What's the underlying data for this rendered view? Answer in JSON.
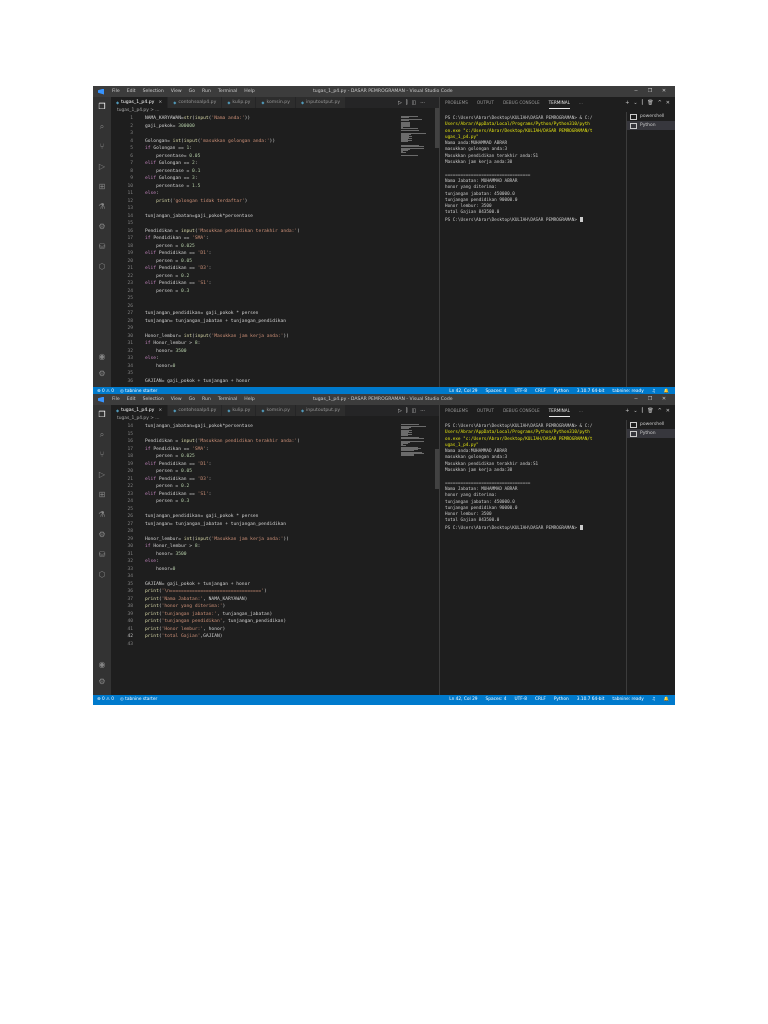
{
  "titlebar": {
    "menu": [
      "File",
      "Edit",
      "Selection",
      "View",
      "Go",
      "Run",
      "Terminal",
      "Help"
    ],
    "title": "tugas_1_p4.py - DASAR PEMROGRAMAN - Visual Studio Code",
    "controls": [
      "─",
      "❐",
      "✕"
    ]
  },
  "tabs": [
    {
      "label": "tugas_1_p4.py",
      "active": true
    },
    {
      "label": "contohsoalp4.py",
      "active": false
    },
    {
      "label": "kulip.py",
      "active": false
    },
    {
      "label": "komsin.py",
      "active": false
    },
    {
      "label": "inputoutput.py",
      "active": false
    }
  ],
  "editor_actions": [
    "▷",
    "⫿",
    "◫",
    "⋯"
  ],
  "breadcrumb": "tugas_1_p4.py > ...",
  "code_top": [
    {
      "n": "1",
      "t": "NAMA_KARYAWAN=str(input('Nama anda:'))"
    },
    {
      "n": "2",
      "t": "gaji_pokok= 300000"
    },
    {
      "n": "3",
      "t": ""
    },
    {
      "n": "4",
      "t": "Golongan= int(input('masukkan golongan anda:'))"
    },
    {
      "n": "5",
      "t": "if Golongan == 1:"
    },
    {
      "n": "6",
      "t": "    persentase= 0.05"
    },
    {
      "n": "7",
      "t": "elif Golongan == 2:"
    },
    {
      "n": "8",
      "t": "    persentase = 0.1"
    },
    {
      "n": "9",
      "t": "elif Golongan == 3:"
    },
    {
      "n": "10",
      "t": "    persentase = 1.5"
    },
    {
      "n": "11",
      "t": "else:"
    },
    {
      "n": "12",
      "t": "    print('golongan tidak terdaftar')"
    },
    {
      "n": "13",
      "t": ""
    },
    {
      "n": "14",
      "t": "tunjangan_jabatan=gaji_pokok*persentase"
    },
    {
      "n": "15",
      "t": ""
    },
    {
      "n": "16",
      "t": "Pendidikan = input('Masukkan pendidikan terakhir anda:')"
    },
    {
      "n": "17",
      "t": "if Pendidikan == 'SMA':"
    },
    {
      "n": "18",
      "t": "    persen = 0.025"
    },
    {
      "n": "19",
      "t": "elif Pendidikan == 'D1':"
    },
    {
      "n": "20",
      "t": "    persen = 0.05"
    },
    {
      "n": "21",
      "t": "elif Pendidikan == 'D3':"
    },
    {
      "n": "22",
      "t": "    persen = 0.2"
    },
    {
      "n": "23",
      "t": "elif Pendidikan == 'S1':"
    },
    {
      "n": "24",
      "t": "    persen = 0.3"
    },
    {
      "n": "25",
      "t": ""
    },
    {
      "n": "26",
      "t": ""
    },
    {
      "n": "27",
      "t": "tunjangan_pendidikan= gaji_pokok * persen"
    },
    {
      "n": "28",
      "t": "tunjangan= tunjangan_jabatan + tunjangan_pendidikan"
    },
    {
      "n": "29",
      "t": ""
    },
    {
      "n": "30",
      "t": "Honor_lembur= int(input('Masukkan jam kerja anda:'))"
    },
    {
      "n": "31",
      "t": "if Honor_lembur > 8:"
    },
    {
      "n": "32",
      "t": "    honor= 3500"
    },
    {
      "n": "33",
      "t": "else:"
    },
    {
      "n": "34",
      "t": "    honor=0"
    },
    {
      "n": "35",
      "t": ""
    },
    {
      "n": "36",
      "t": "GAJIAN= gaji_pokok + tunjangan + honor"
    }
  ],
  "code_bottom": [
    {
      "n": "14",
      "t": "tunjangan_jabatan=gaji_pokok*persentase"
    },
    {
      "n": "15",
      "t": ""
    },
    {
      "n": "16",
      "t": "Pendidikan = input('Masukkan pendidikan terakhir anda:')"
    },
    {
      "n": "17",
      "t": "if Pendidikan == 'SMA':"
    },
    {
      "n": "18",
      "t": "    persen = 0.025"
    },
    {
      "n": "19",
      "t": "elif Pendidikan == 'D1':"
    },
    {
      "n": "20",
      "t": "    persen = 0.05"
    },
    {
      "n": "21",
      "t": "elif Pendidikan == 'D3':"
    },
    {
      "n": "22",
      "t": "    persen = 0.2"
    },
    {
      "n": "23",
      "t": "elif Pendidikan == 'S1':"
    },
    {
      "n": "24",
      "t": "    persen = 0.3"
    },
    {
      "n": "25",
      "t": ""
    },
    {
      "n": "26",
      "t": "tunjangan_pendidikan= gaji_pokok * persen"
    },
    {
      "n": "27",
      "t": "tunjangan= tunjangan_jabatan + tunjangan_pendidikan"
    },
    {
      "n": "28",
      "t": ""
    },
    {
      "n": "29",
      "t": "Honor_lembur= int(input('Masukkan jam kerja anda:'))"
    },
    {
      "n": "30",
      "t": "if Honor_lembur > 8:"
    },
    {
      "n": "31",
      "t": "    honor= 3500"
    },
    {
      "n": "32",
      "t": "else:"
    },
    {
      "n": "33",
      "t": "    honor=0"
    },
    {
      "n": "34",
      "t": ""
    },
    {
      "n": "35",
      "t": "GAJIAN= gaji_pokok + tunjangan + honor"
    },
    {
      "n": "36",
      "t": "print('\\n=================================')"
    },
    {
      "n": "37",
      "t": "print('Nama Jabatan:', NAMA_KARYAWAN)"
    },
    {
      "n": "38",
      "t": "print('honor yang diterima:')"
    },
    {
      "n": "39",
      "t": "print('tunjangan jabatan:', tunjangan_jabatan)"
    },
    {
      "n": "40",
      "t": "print('tunjangan pendidikan', tunjangan_pendidikan)"
    },
    {
      "n": "41",
      "t": "print('Honor lembur:', honor)"
    },
    {
      "n": "42",
      "t": "print('total Gajian',GAJIAN)"
    },
    {
      "n": "43",
      "t": ""
    }
  ],
  "panel": {
    "tabs": [
      "PROBLEMS",
      "OUTPUT",
      "DEBUG CONSOLE",
      "TERMINAL",
      "..."
    ],
    "active_tab": "TERMINAL",
    "actions": [
      "+",
      "⌄",
      "⫿",
      "🗑",
      "^",
      "✕"
    ],
    "terminals": [
      "powershell",
      "Python"
    ],
    "terminal_lines": [
      {
        "t": "PS C:\\Users\\Abrar\\Desktop\\KULIAH\\DASAR PEMROGRAMAN> & C:/",
        "y": false
      },
      {
        "t": "Users/Abrar/AppData/Local/Programs/Python/Python310/pyth",
        "y": true
      },
      {
        "t": "on.exe \"c:/Users/Abrar/Desktop/KULIAH/DASAR PEMROGRAMAN/t",
        "y": true
      },
      {
        "t": "ugas_1_p4.py\"",
        "y": true
      },
      {
        "t": "Nama anda:MUHAMMAD ABRAR",
        "y": false
      },
      {
        "t": "masukkan golongan anda:3",
        "y": false
      },
      {
        "t": "Masukkan pendidikan terakhir anda:S1",
        "y": false
      },
      {
        "t": "Masukkan jam kerja anda:30",
        "y": false
      },
      {
        "t": "",
        "y": false
      },
      {
        "t": "=================================",
        "y": false
      },
      {
        "t": "Nama Jabatan: MUHAMMAD ABRAR",
        "y": false
      },
      {
        "t": "honor yang diterima:",
        "y": false
      },
      {
        "t": "tunjangan jabatan: 450000.0",
        "y": false
      },
      {
        "t": "tunjangan pendidikan 90000.0",
        "y": false
      },
      {
        "t": "Honor lembur: 3500",
        "y": false
      },
      {
        "t": "total Gajian 843500.0",
        "y": false
      },
      {
        "t": "PS C:\\Users\\Abrar\\Desktop\\KULIAH\\DASAR PEMROGRAMAN> ",
        "y": false
      }
    ]
  },
  "statusbar": {
    "left": [
      "⊗ 0 ⚠ 0",
      "◎ tabnine starter"
    ],
    "right": [
      "Ln 42, Col 29",
      "Spaces: 4",
      "UTF-8",
      "CRLF",
      "Python",
      "3.10.7 64-bit",
      "tabnine: ready",
      "♫",
      "🔔"
    ]
  },
  "colors": {
    "accent": "#007acc",
    "editor_bg": "#1e1e1e",
    "string": "#ce9178",
    "keyword": "#c586c0",
    "function": "#dcdcaa",
    "number": "#b5cea8",
    "variable": "#9cdcfe"
  }
}
